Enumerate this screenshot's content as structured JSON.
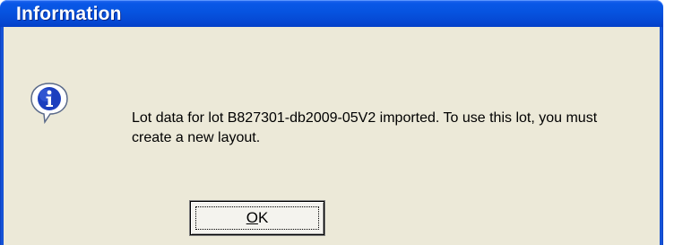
{
  "dialog": {
    "title": "Information",
    "message": "Lot data for lot B827301-db2009-05V2 imported. To use this lot, you must create a new layout.",
    "icon": "info-icon",
    "ok_button": {
      "mnemonic": "O",
      "label_rest": "K"
    }
  },
  "colors": {
    "titlebar": "#0653df",
    "client": "#ece9d8",
    "icon_blue": "#1c3fbe"
  }
}
